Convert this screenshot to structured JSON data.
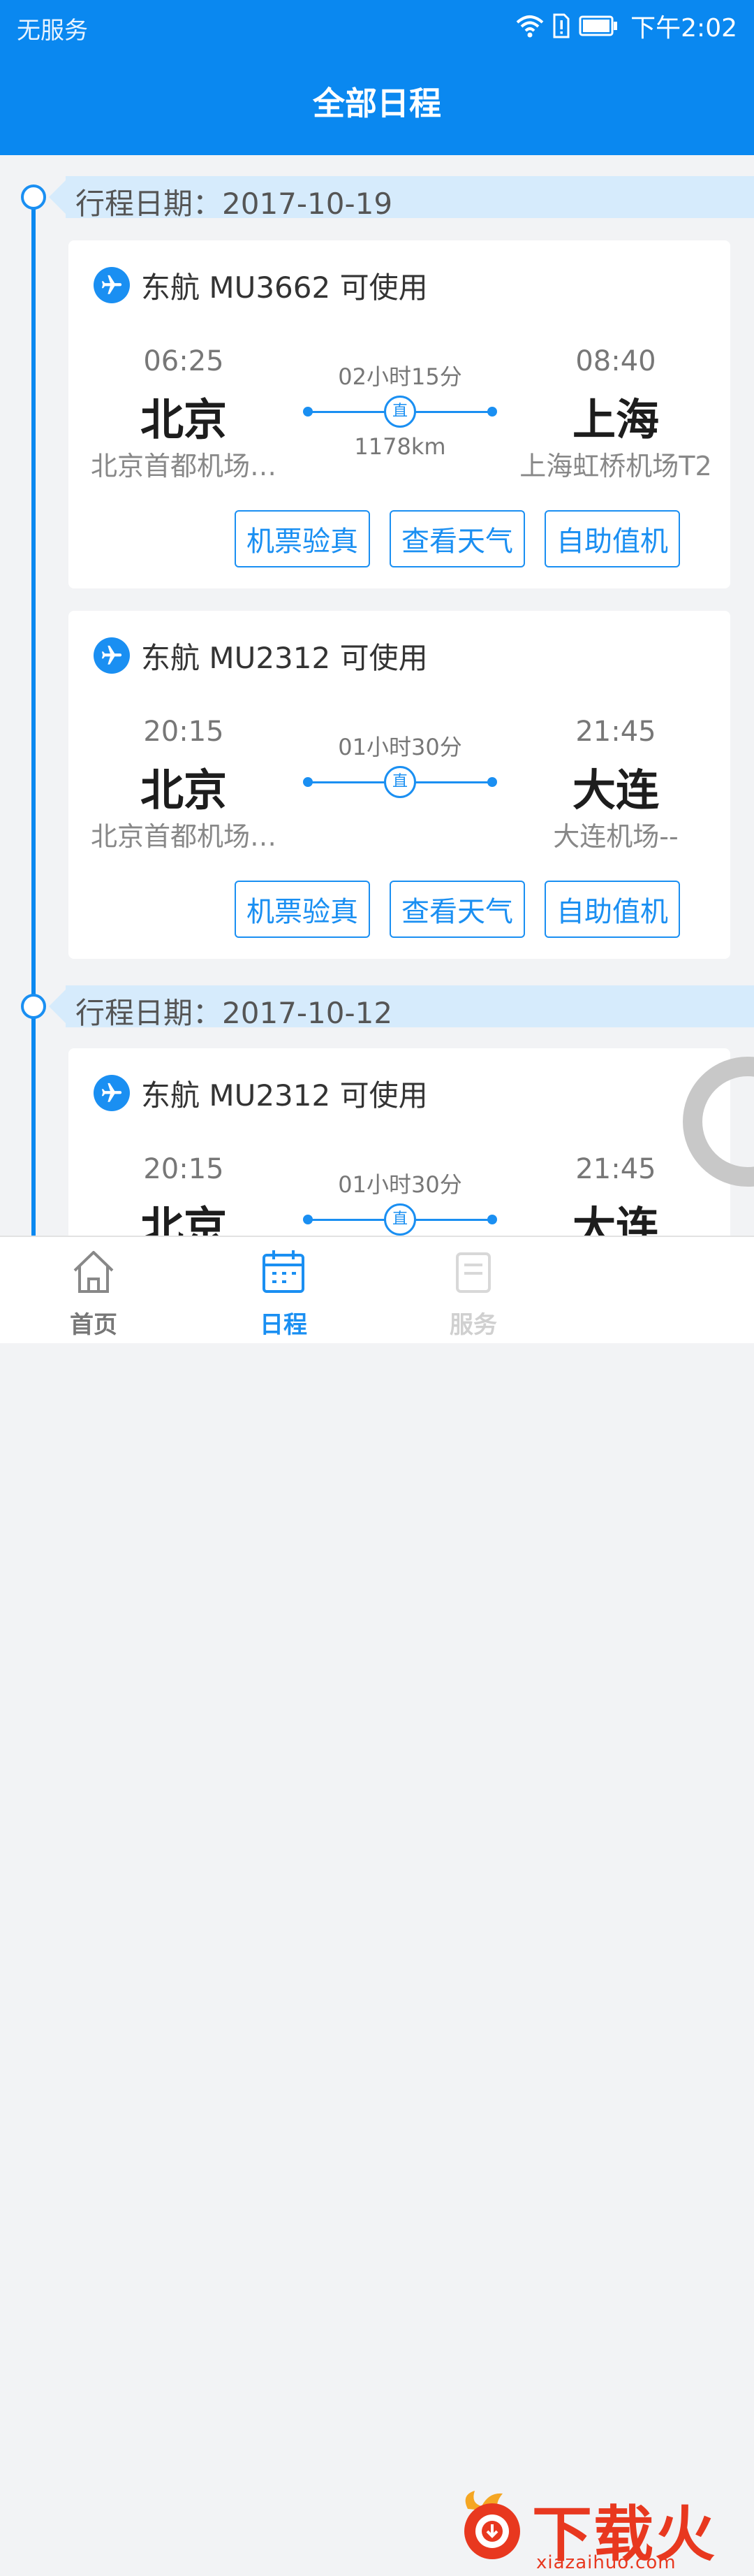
{
  "status_bar": {
    "carrier": "无服务",
    "time": "下午2:02"
  },
  "header": {
    "title": "全部日程"
  },
  "groups": [
    {
      "date_label": "行程日期：2017-10-19",
      "flights": [
        {
          "title": "东航 MU3662 可使用",
          "dep_time": "06:25",
          "dep_city": "北京",
          "dep_airport": "北京首都机场…",
          "duration": "02小时15分",
          "stop_label": "直",
          "distance": "1178km",
          "arr_time": "08:40",
          "arr_city": "上海",
          "arr_airport": "上海虹桥机场T2",
          "actions": [
            "机票验真",
            "查看天气",
            "自助值机"
          ]
        },
        {
          "title": "东航 MU2312 可使用",
          "dep_time": "20:15",
          "dep_city": "北京",
          "dep_airport": "北京首都机场…",
          "duration": "01小时30分",
          "stop_label": "直",
          "distance": "",
          "arr_time": "21:45",
          "arr_city": "大连",
          "arr_airport": "大连机场--",
          "actions": [
            "机票验真",
            "查看天气",
            "自助值机"
          ]
        }
      ]
    },
    {
      "date_label": "行程日期：2017-10-12",
      "flights": [
        {
          "title": "东航 MU2312 可使用",
          "dep_time": "20:15",
          "dep_city": "北京",
          "duration": "01小时30分",
          "stop_label": "直",
          "arr_time": "21:45",
          "arr_city": "大连"
        }
      ]
    }
  ],
  "tabbar": {
    "items": [
      {
        "label": "首页"
      },
      {
        "label": "日程"
      },
      {
        "label": "服务"
      }
    ]
  },
  "watermark": {
    "text": "下载火",
    "url": "xiazaihuo.com"
  },
  "colors": {
    "primary": "#0a88f0",
    "date_bar": "#d6ebfc",
    "background": "#f2f3f5",
    "watermark": "#e8381f"
  }
}
